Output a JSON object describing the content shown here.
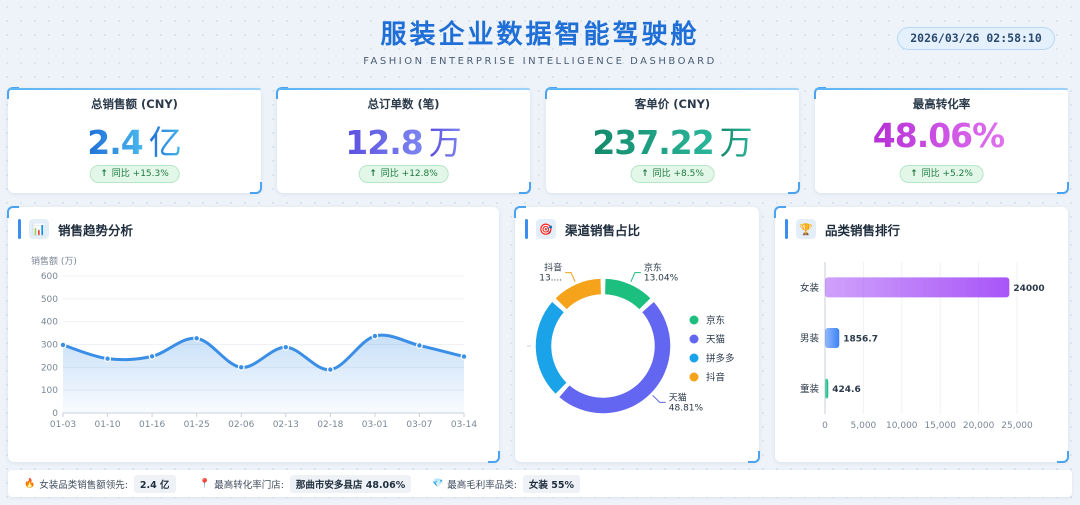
{
  "header": {
    "title": "服装企业数据智能驾驶舱",
    "subtitle": "FASHION ENTERPRISE INTELLIGENCE DASHBOARD",
    "datetime": "2026/03/26 02:58:10"
  },
  "kpis": [
    {
      "label": "总销售额 (CNY)",
      "value": "2.4",
      "unit": "亿",
      "badge_prefix": "同比",
      "change": "+15.3%",
      "color_from": "#1f6fd6",
      "color_to": "#49b8ee"
    },
    {
      "label": "总订单数 (笔)",
      "value": "12.8",
      "unit": "万",
      "badge_prefix": "同比",
      "change": "+12.8%",
      "color_from": "#5b4fe0",
      "color_to": "#7d86ef"
    },
    {
      "label": "客单价 (CNY)",
      "value": "237.22",
      "unit": "万",
      "badge_prefix": "同比",
      "change": "+8.5%",
      "color_from": "#13896a",
      "color_to": "#2bb69b"
    },
    {
      "label": "最高转化率",
      "value": "48.06%",
      "unit": "",
      "badge_prefix": "同比",
      "change": "+5.2%",
      "color_from": "#b62fd6",
      "color_to": "#e072ef"
    }
  ],
  "panels": {
    "trend": {
      "title": "销售趋势分析",
      "icon": "bar-chart-icon"
    },
    "channel": {
      "title": "渠道销售占比",
      "icon": "target-icon"
    },
    "category": {
      "title": "品类销售排行",
      "icon": "trophy-icon"
    }
  },
  "chart_data": [
    {
      "type": "line",
      "ylabel": "销售额 (万)",
      "x": [
        "01-03",
        "01-10",
        "01-16",
        "01-25",
        "02-06",
        "02-13",
        "02-18",
        "03-01",
        "03-07",
        "03-14"
      ],
      "values": [
        298,
        238,
        248,
        327,
        200,
        288,
        190,
        337,
        296,
        247
      ],
      "ylim": [
        0,
        600
      ],
      "yticks": [
        0,
        100,
        200,
        300,
        400,
        500,
        600
      ],
      "color": "#3a8ee6",
      "smooth": true,
      "area": true,
      "grid": true
    },
    {
      "type": "pie",
      "donut": true,
      "slices": [
        {
          "name": "京东",
          "value": 13.04,
          "label": "13.04%",
          "color": "#1dbf7e"
        },
        {
          "name": "天猫",
          "value": 48.81,
          "label": "48.81%",
          "color": "#6366f1"
        },
        {
          "name": "拼多多",
          "value": 25.11,
          "label": "",
          "color": "#1aa3e8"
        },
        {
          "name": "抖音",
          "value": 13.04,
          "label": "13....",
          "color": "#f5a31a"
        }
      ],
      "legend": "right"
    },
    {
      "type": "bar",
      "orientation": "horizontal",
      "categories": [
        "女装",
        "男装",
        "童装"
      ],
      "values": [
        24000,
        1856.7,
        424.6
      ],
      "value_labels": [
        "24000",
        "1856.7",
        "424.6"
      ],
      "xlim": [
        0,
        25000
      ],
      "xticks": [
        0,
        5000,
        10000,
        15000,
        20000,
        25000
      ],
      "xtick_labels": [
        "0",
        "5,000",
        "10,000",
        "15,000",
        "20,000",
        "25,000"
      ],
      "colors": [
        "#a855f7",
        "#3b82f6",
        "#10b981"
      ]
    }
  ],
  "footer": [
    {
      "icon": "flame-icon",
      "glyph": "🔥",
      "label": "女装品类销售额领先:",
      "value": "2.4 亿"
    },
    {
      "icon": "pin-icon",
      "glyph": "📍",
      "label": "最高转化率门店:",
      "value": "那曲市安多县店 48.06%"
    },
    {
      "icon": "diamond-icon",
      "glyph": "💎",
      "label": "最高毛利率品类:",
      "value": "女装 55%"
    }
  ]
}
